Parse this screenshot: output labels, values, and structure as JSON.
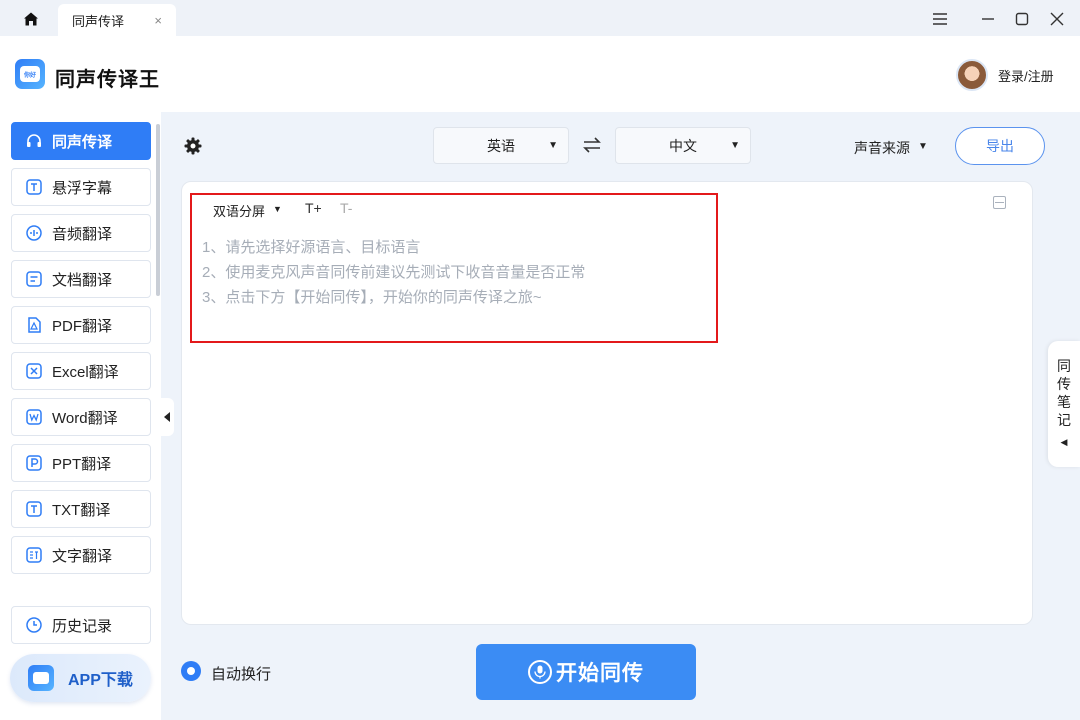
{
  "titlebar": {
    "tab_label": "同声传译",
    "tab_close": "×"
  },
  "header": {
    "app_name": "同声传译王",
    "login_text": "登录/注册",
    "logo_text": "你好"
  },
  "sidebar": {
    "items": [
      {
        "label": "同声传译",
        "icon": "headphones-icon"
      },
      {
        "label": "悬浮字幕",
        "icon": "subtitle-icon"
      },
      {
        "label": "音频翻译",
        "icon": "audio-icon"
      },
      {
        "label": "文档翻译",
        "icon": "document-icon"
      },
      {
        "label": "PDF翻译",
        "icon": "pdf-icon"
      },
      {
        "label": "Excel翻译",
        "icon": "excel-icon"
      },
      {
        "label": "Word翻译",
        "icon": "word-icon"
      },
      {
        "label": "PPT翻译",
        "icon": "ppt-icon"
      },
      {
        "label": "TXT翻译",
        "icon": "txt-icon"
      },
      {
        "label": "文字翻译",
        "icon": "text-translate-icon"
      }
    ],
    "history_label": "历史记录",
    "app_download_label": "APP下载"
  },
  "toolbar": {
    "source_lang": "英语",
    "target_lang": "中文",
    "sound_source_label": "声音来源",
    "export_label": "导出"
  },
  "panel": {
    "split_label": "双语分屏",
    "font_increase": "T+",
    "font_decrease": "T-",
    "hints": [
      "1、请先选择好源语言、目标语言",
      "2、使用麦克风声音同传前建议先测试下收音音量是否正常",
      "3、点击下方【开始同传】，开始你的同声传译之旅~"
    ]
  },
  "notes_tab": {
    "chars": [
      "同",
      "传",
      "笔",
      "记"
    ]
  },
  "footer": {
    "auto_wrap_label": "自动换行",
    "start_label": "开始同传"
  },
  "colors": {
    "accent": "#2f7df6",
    "highlight_box": "#e3191b"
  }
}
